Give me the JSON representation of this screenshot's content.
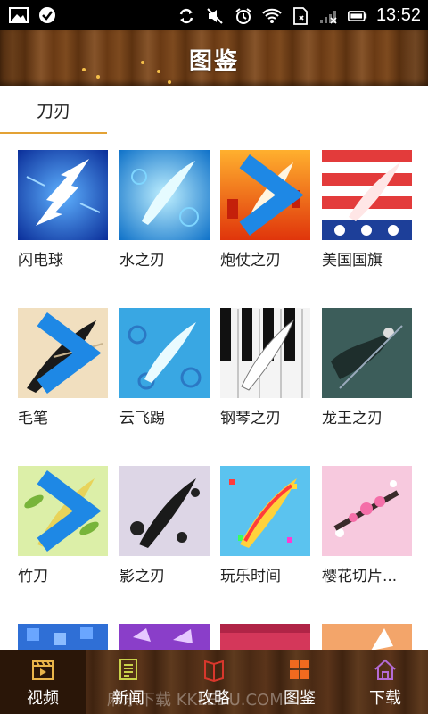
{
  "status": {
    "time": "13:52",
    "icons": [
      "image-icon",
      "check-circle-icon",
      "sync-icon",
      "mute-icon",
      "alarm-icon",
      "wifi-icon",
      "sim-icon",
      "signal-icon",
      "battery-icon"
    ]
  },
  "header": {
    "title": "图鉴"
  },
  "tabs": [
    {
      "label": "刀刃",
      "active": true
    }
  ],
  "items": [
    {
      "label": "闪电球"
    },
    {
      "label": "水之刃"
    },
    {
      "label": "炮仗之刃"
    },
    {
      "label": "美国国旗"
    },
    {
      "label": "毛笔"
    },
    {
      "label": "云飞踢"
    },
    {
      "label": "钢琴之刃"
    },
    {
      "label": "龙王之刃"
    },
    {
      "label": "竹刀"
    },
    {
      "label": "影之刃"
    },
    {
      "label": "玩乐时间"
    },
    {
      "label": "樱花切片..."
    },
    {
      "label": ""
    },
    {
      "label": ""
    },
    {
      "label": ""
    },
    {
      "label": ""
    }
  ],
  "nav": [
    {
      "label": "视频",
      "icon": "video-icon",
      "active": true
    },
    {
      "label": "新闻",
      "icon": "news-icon",
      "active": false
    },
    {
      "label": "攻略",
      "icon": "guide-icon",
      "active": false
    },
    {
      "label": "图鉴",
      "icon": "catalog-icon",
      "active": false
    },
    {
      "label": "下载",
      "icon": "download-icon",
      "active": false
    }
  ],
  "watermark": "麻乐下载 KKLEDU.COM"
}
